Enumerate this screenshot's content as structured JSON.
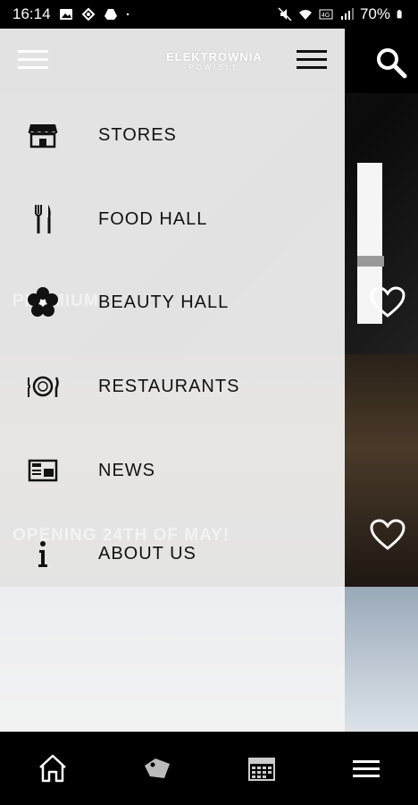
{
  "status_bar": {
    "time": "16:14",
    "battery": "70%",
    "icons": [
      "photo-icon",
      "sync-icon",
      "drive-icon",
      "dot-icon",
      "mute-icon",
      "wifi-icon",
      "volte-icon",
      "signal-icon",
      "battery-icon"
    ]
  },
  "header": {
    "logo_text": "ELEKTROWNIA",
    "logo_subtext": "POWIŚLE"
  },
  "drawer": {
    "items": [
      {
        "label": "STORES",
        "icon": "store-icon"
      },
      {
        "label": "FOOD HALL",
        "icon": "cutlery-icon"
      },
      {
        "label": "BEAUTY HALL",
        "icon": "flower-icon"
      },
      {
        "label": "RESTAURANTS",
        "icon": "plate-icon"
      },
      {
        "label": "NEWS",
        "icon": "newspaper-icon"
      },
      {
        "label": "ABOUT US",
        "icon": "info-icon"
      }
    ]
  },
  "background": {
    "card1_text": "PREMIUM",
    "card2_text": "OPENING 24TH OF MAY!"
  },
  "bottom_nav": {
    "items": [
      "home-icon",
      "tag-icon",
      "calendar-icon",
      "menu-icon"
    ]
  },
  "colors": {
    "bar_bg": "#000000",
    "drawer_bg": "#f3f3f3",
    "text": "#111111"
  }
}
